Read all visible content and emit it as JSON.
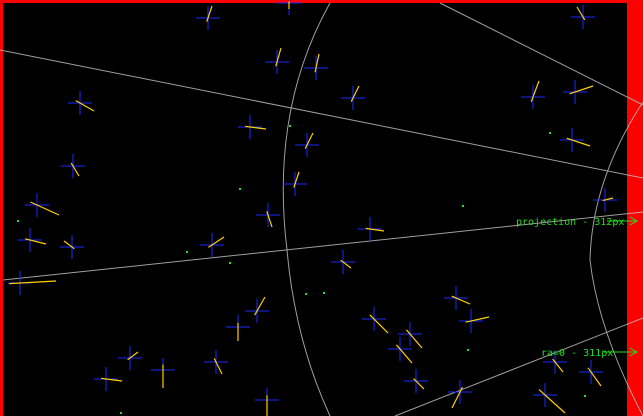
{
  "window": {
    "frame_color": "#ff0000",
    "sky_color": "#000000"
  },
  "colors": {
    "grid": "#bbbbbb",
    "star_cross": "#1a2bff",
    "vector": "#ffd000",
    "annotation": "#22dd22",
    "dot": "#22dd22"
  },
  "annotations": [
    {
      "id": "projection",
      "label": "projection - 312px"
    },
    {
      "id": "radius",
      "label": "ra=0 - 311px"
    }
  ]
}
